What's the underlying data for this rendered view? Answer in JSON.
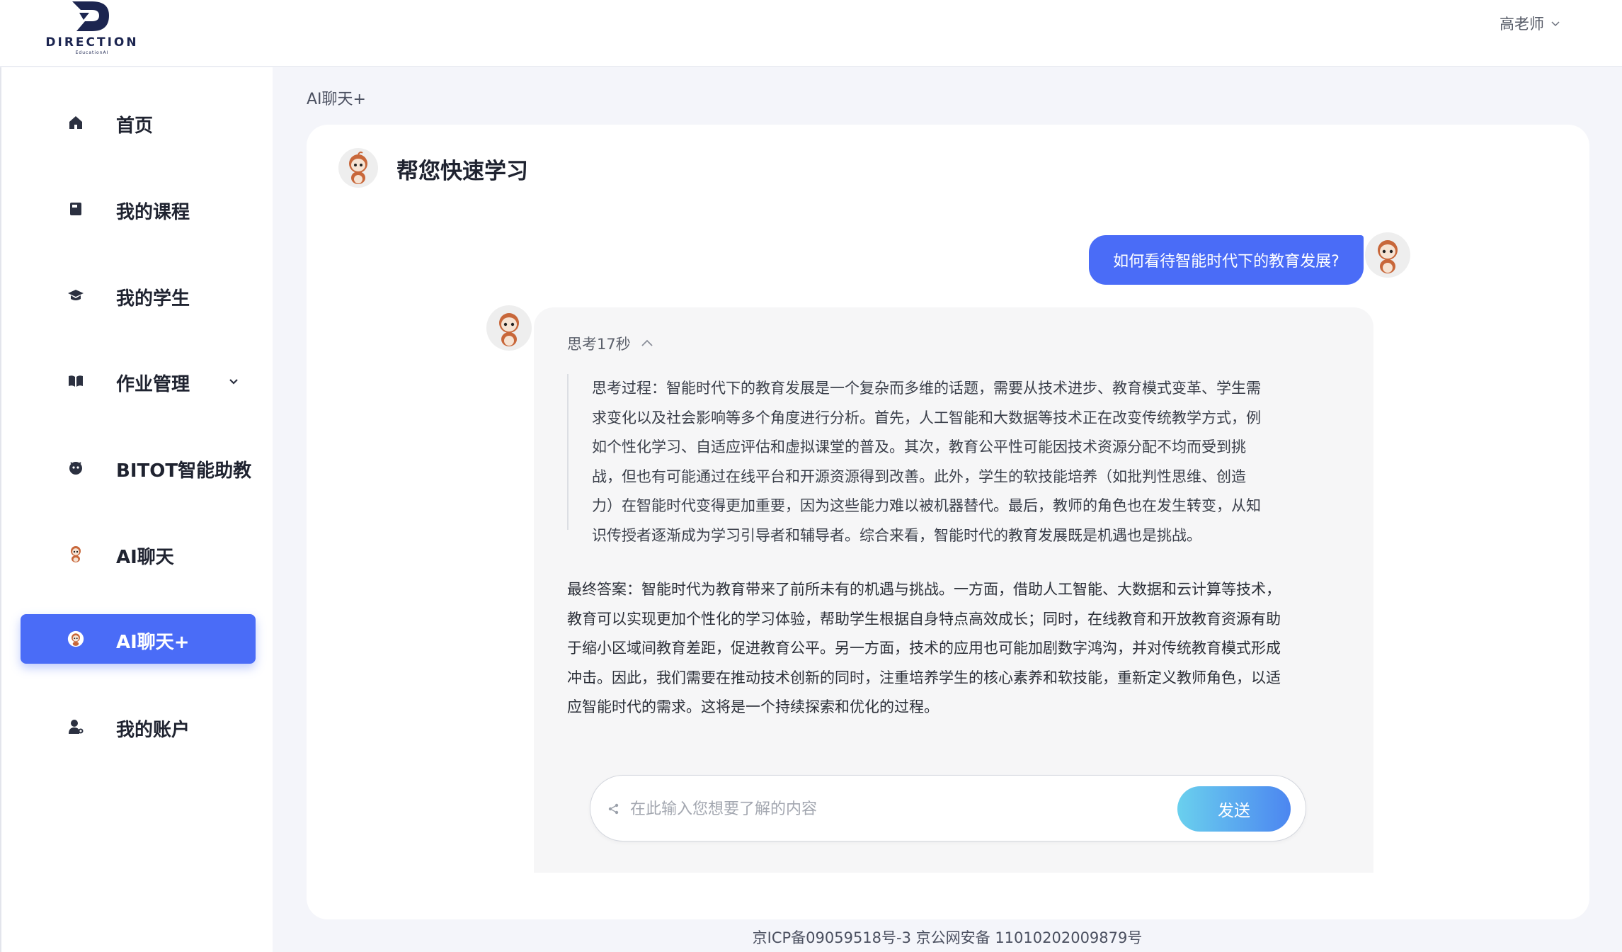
{
  "header": {
    "logo_text": "DIRECTION",
    "logo_subtext": "EducationAI",
    "user_name": "高老师"
  },
  "sidebar": {
    "items": [
      {
        "label": "首页",
        "icon": "home-icon"
      },
      {
        "label": "我的课程",
        "icon": "course-icon"
      },
      {
        "label": "我的学生",
        "icon": "graduation-cap-icon"
      },
      {
        "label": "作业管理",
        "icon": "book-icon",
        "expandable": true
      },
      {
        "label": "BITOT智能助教",
        "icon": "robot-icon"
      },
      {
        "label": "AI聊天",
        "icon": "mascot-icon"
      },
      {
        "label": "AI聊天+",
        "icon": "mascot-icon",
        "active": true
      },
      {
        "label": "我的账户",
        "icon": "user-icon"
      }
    ]
  },
  "breadcrumb": "AI聊天+",
  "chat": {
    "title": "帮您快速学习",
    "user_message": "如何看待智能时代下的教育发展?",
    "thinking_label": "思考17秒",
    "thinking_lines": [
      "思考过程：智能时代下的教育发展是一个复杂而多维的话题，需要从技术进步、教育模式变革、学生需",
      "求变化以及社会影响等多个角度进行分析。首先，人工智能和大数据等技术正在改变传统教学方式，例",
      "如个性化学习、自适应评估和虚拟课堂的普及。其次，教育公平性可能因技术资源分配不均而受到挑",
      "战，但也有可能通过在线平台和开源资源得到改善。此外，学生的软技能培养（如批判性思维、创造",
      "力）在智能时代变得更加重要，因为这些能力难以被机器替代。最后，教师的角色也在发生转变，从知",
      "识传授者逐渐成为学习引导者和辅导者。综合来看，智能时代的教育发展既是机遇也是挑战。"
    ],
    "answer_lines": [
      "最终答案：智能时代为教育带来了前所未有的机遇与挑战。一方面，借助人工智能、大数据和云计算等技术，",
      "教育可以实现更加个性化的学习体验，帮助学生根据自身特点高效成长；同时，在线教育和开放教育资源有助",
      "于缩小区域间教育差距，促进教育公平。另一方面，技术的应用也可能加剧数字鸿沟，并对传统教育模式形成",
      "冲击。因此，我们需要在推动技术创新的同时，注重培养学生的核心素养和软技能，重新定义教师角色，以适",
      "应智能时代的需求。这将是一个持续探索和优化的过程。"
    ],
    "input_placeholder": "在此输入您想要了解的内容",
    "input_value": "",
    "send_label": "发送"
  },
  "footer": {
    "icp": "京ICP备09059518号-3 京公网安备 11010202009879号"
  },
  "colors": {
    "accent": "#4a6cf7",
    "send_gradient_start": "#6ad0ee",
    "send_gradient_end": "#4c86f0",
    "page_bg": "#f4f5fa"
  }
}
